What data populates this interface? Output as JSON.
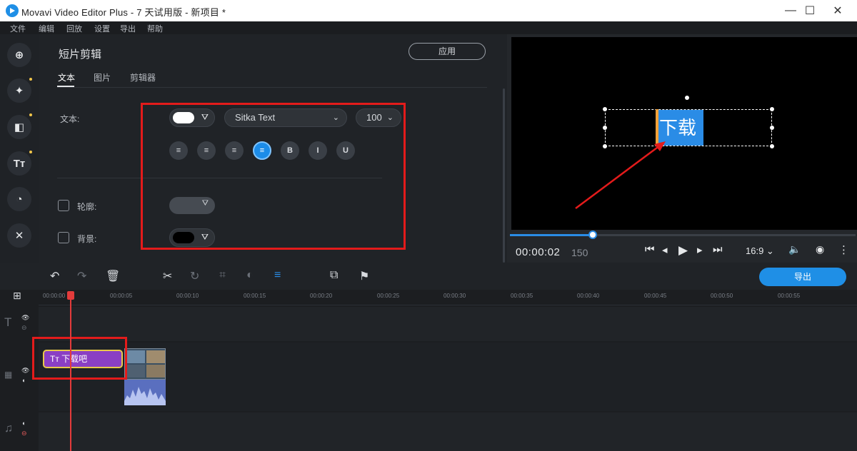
{
  "window": {
    "title": "Movavi Video Editor Plus - 7 天试用版 - 新项目 *",
    "controls": {
      "minimize": "—",
      "maximize": "☐",
      "close": "✕"
    }
  },
  "menu": [
    "文件",
    "编辑",
    "回放",
    "设置",
    "导出",
    "帮助"
  ],
  "sidebar": {
    "tools": [
      {
        "icon": "import-icon",
        "glyph": "⊕"
      },
      {
        "icon": "magic-wand-icon",
        "glyph": "✦"
      },
      {
        "icon": "transitions-icon",
        "glyph": "◧"
      },
      {
        "icon": "titles-icon",
        "glyph": "Tт"
      },
      {
        "icon": "stickers-icon",
        "glyph": "◔"
      },
      {
        "icon": "more-tools-icon",
        "glyph": "✕"
      }
    ]
  },
  "editor": {
    "title": "短片剪辑",
    "apply_label": "应用",
    "tabs": [
      "文本",
      "图片",
      "剪辑器"
    ],
    "active_tab": "文本",
    "text_label": "文本:",
    "font_name": "Sitka Text",
    "font_size": "100",
    "outline_label": "轮廓:",
    "background_label": "背景:",
    "format_buttons": [
      {
        "icon": "align-left-icon",
        "glyph": "≡"
      },
      {
        "icon": "align-right-icon",
        "glyph": "≡"
      },
      {
        "icon": "justify-icon",
        "glyph": "≡"
      },
      {
        "icon": "align-center-icon",
        "glyph": "≡"
      },
      {
        "icon": "bold-icon",
        "glyph": "B"
      },
      {
        "icon": "italic-icon",
        "glyph": "I"
      },
      {
        "icon": "underline-icon",
        "glyph": "U"
      }
    ],
    "active_format_index": 3,
    "colors": {
      "text_color": "#ffffff",
      "background_color": "#000000",
      "accent": "#1f8fe6",
      "highlight_box": "#e31b1b"
    }
  },
  "preview": {
    "caption_text": "下载",
    "timecode": "00:00:02",
    "frames": "150",
    "aspect_ratio": "16:9",
    "progress": 0.24,
    "controls": [
      "⏮",
      "◂",
      "▶",
      "▸",
      "⏭"
    ]
  },
  "timeline": {
    "export_label": "导出",
    "ruler_labels": [
      "00:00:00",
      "00:00:05",
      "00:00:10",
      "00:00:15",
      "00:00:20",
      "00:00:25",
      "00:00:30",
      "00:00:35",
      "00:00:40",
      "00:00:45",
      "00:00:50",
      "00:00:55"
    ],
    "text_clip_label": "Tт  下载吧",
    "playhead_time": "00:00:02"
  }
}
